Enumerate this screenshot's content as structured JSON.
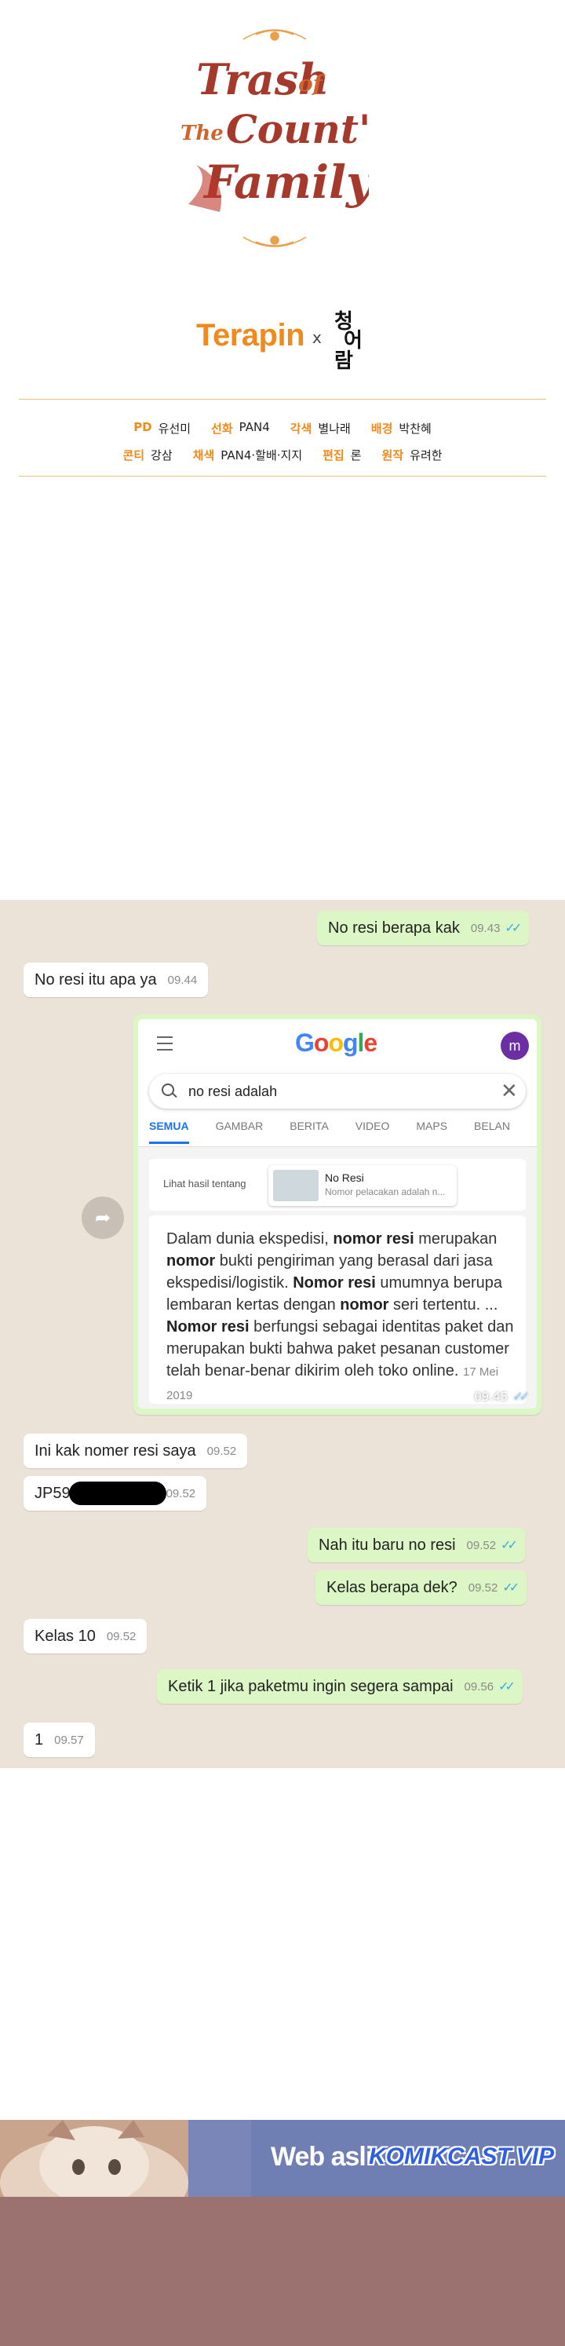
{
  "header": {
    "title_logo_lines": [
      "Trash",
      "of",
      "The",
      "Count's",
      "Family"
    ],
    "partner": "Terapin",
    "partner_times": "x",
    "partner2_chars": [
      "청",
      "어",
      "람"
    ]
  },
  "credits": [
    [
      {
        "role": "PD",
        "name": "유선미"
      },
      {
        "role": "선화",
        "name": "PAN4"
      },
      {
        "role": "각색",
        "name": "별나래"
      },
      {
        "role": "배경",
        "name": "박찬혜"
      }
    ],
    [
      {
        "role": "콘티",
        "name": "강삼"
      },
      {
        "role": "채색",
        "name": "PAN4·할배·지지"
      },
      {
        "role": "편집",
        "name": "론"
      },
      {
        "role": "원작",
        "name": "유려한"
      }
    ]
  ],
  "chat": {
    "messages": [
      {
        "dir": "out",
        "text": "No resi berapa kak",
        "time": "09.43",
        "ticks": "✓✓"
      },
      {
        "dir": "in",
        "text": "No resi itu apa ya",
        "time": "09.44"
      },
      {
        "dir": "in",
        "text": "Ini kak nomer resi saya",
        "time": "09.52"
      },
      {
        "dir": "in",
        "text": "JP59",
        "time": "09.52"
      },
      {
        "dir": "out",
        "text": "Nah itu baru no resi",
        "time": "09.52",
        "ticks": "✓✓"
      },
      {
        "dir": "out",
        "text": "Kelas berapa dek?",
        "time": "09.52",
        "ticks": "✓✓"
      },
      {
        "dir": "in",
        "text": "Kelas 10",
        "time": "09.52"
      },
      {
        "dir": "out",
        "text": "Ketik 1 jika paketmu ingin segera sampai",
        "time": "09.56",
        "ticks": "✓✓"
      },
      {
        "dir": "in",
        "text": "1",
        "time": "09.57"
      }
    ],
    "share_icon": "share-icon",
    "image_message": {
      "time": "09.45",
      "ticks": "✓✓",
      "google": {
        "logo": "Google",
        "logo_colors": [
          "#4285F4",
          "#EA4335",
          "#FBBC05",
          "#4285F4",
          "#34A853",
          "#EA4335"
        ],
        "avatar_letter": "m",
        "query": "no resi adalah",
        "tabs": [
          "SEMUA",
          "GAMBAR",
          "BERITA",
          "VIDEO",
          "MAPS",
          "BELAN"
        ],
        "see_results_label": "Lihat hasil tentang",
        "card_title": "No Resi",
        "card_subtitle": "Nomor pelacakan adalah n...",
        "snippet_parts": [
          {
            "t": "Dalam dunia ekspedisi, ",
            "b": false
          },
          {
            "t": "nomor resi",
            "b": true
          },
          {
            "t": " merupakan ",
            "b": false
          },
          {
            "t": "nomor",
            "b": true
          },
          {
            "t": " bukti pengiriman yang berasal dari jasa ekspedisi/logistik. ",
            "b": false
          },
          {
            "t": "Nomor resi",
            "b": true
          },
          {
            "t": " umumnya berupa lembaran kertas dengan ",
            "b": false
          },
          {
            "t": "nomor",
            "b": true
          },
          {
            "t": " seri tertentu. ... ",
            "b": false
          },
          {
            "t": "Nomor resi",
            "b": true
          },
          {
            "t": " berfungsi sebagai identitas paket dan merupakan bukti bahwa paket pesanan customer telah benar-benar dikirim oleh toko online. ",
            "b": false
          }
        ],
        "snippet_date": "17 Mei 2019"
      }
    }
  },
  "banner": {
    "text": "Web asli",
    "site": "KOMIKCAST.VIP"
  },
  "colors": {
    "accent_orange": "#f08a1c",
    "chat_bg": "#ece3d8",
    "bubble_out": "#dcf6c5",
    "bubble_in": "#ffffff",
    "read_ticks": "#3aa9e8",
    "footer": "#9b726f"
  }
}
